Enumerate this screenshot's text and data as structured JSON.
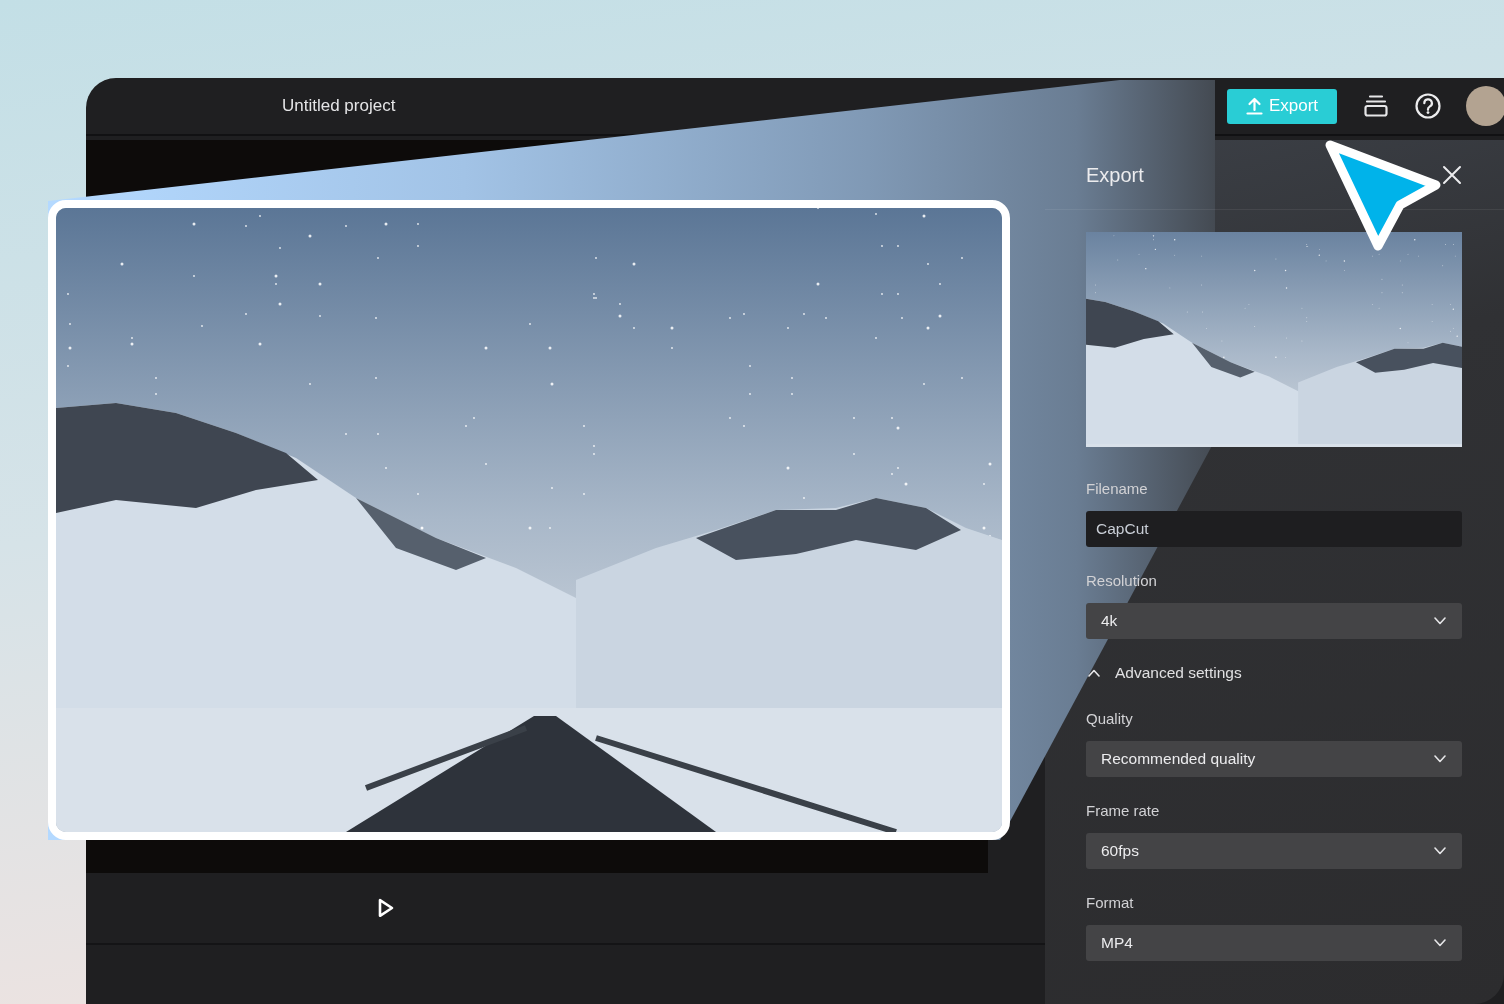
{
  "window": {
    "title": "Untitled project"
  },
  "toolbar": {
    "export_button": "Export"
  },
  "export_panel": {
    "title": "Export",
    "fields": [
      {
        "kind": "input",
        "label": "Filename",
        "value": "CapCut"
      },
      {
        "kind": "select",
        "label": "Resolution",
        "value": "4k"
      }
    ],
    "advanced_settings": {
      "label": "Advanced settings",
      "expanded": true,
      "fields": [
        {
          "kind": "select",
          "label": "Quality",
          "value": "Recommended quality"
        },
        {
          "kind": "select",
          "label": "Frame rate",
          "value": "60fps"
        },
        {
          "kind": "select",
          "label": "Format",
          "value": "MP4"
        }
      ]
    }
  }
}
